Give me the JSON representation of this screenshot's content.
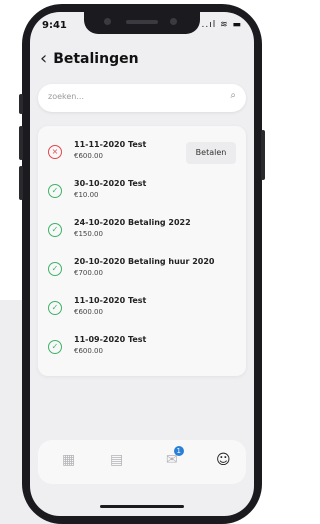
{
  "status": {
    "time": "9:41",
    "icons": "..ıl ≋ ▬"
  },
  "header": {
    "back": "‹",
    "title": "Betalingen"
  },
  "search": {
    "placeholder": "zoeken..."
  },
  "payments": [
    {
      "name": "11-11-2020 Test",
      "amount": "€600.00",
      "status": "unpaid",
      "action": "Betalen"
    },
    {
      "name": "30-10-2020 Test",
      "amount": "€10.00",
      "status": "paid"
    },
    {
      "name": "24-10-2020 Betaling 2022",
      "amount": "€150.00",
      "status": "paid"
    },
    {
      "name": "20-10-2020 Betaling huur 2020",
      "amount": "€700.00",
      "status": "paid"
    },
    {
      "name": "11-10-2020 Test",
      "amount": "€600.00",
      "status": "paid"
    },
    {
      "name": "11-09-2020 Test",
      "amount": "€600.00",
      "status": "paid"
    }
  ],
  "tabbar": {
    "chat_badge": "1"
  },
  "colors": {
    "paid": "#3fb267",
    "unpaid": "#e0484f",
    "badge": "#2a7fd6"
  }
}
